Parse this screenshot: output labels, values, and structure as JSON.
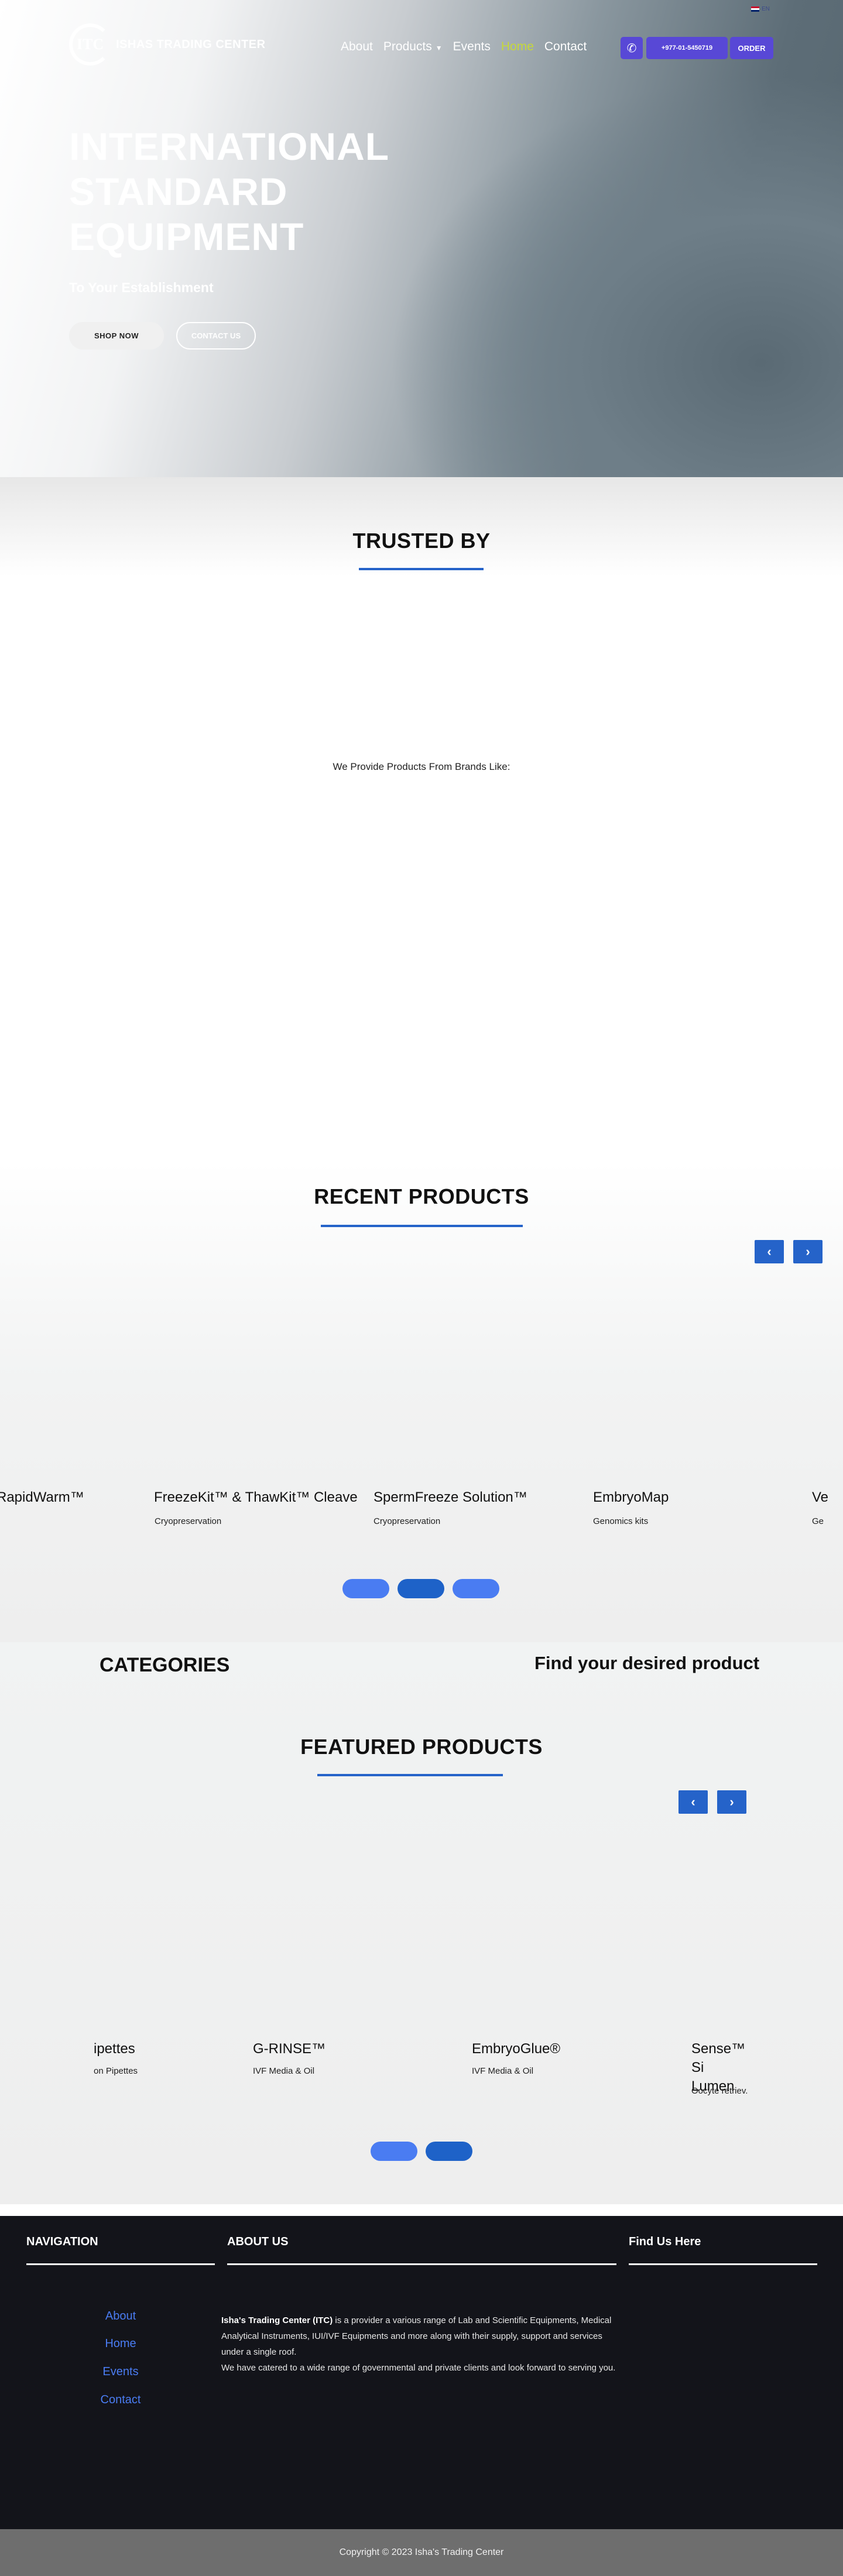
{
  "header": {
    "language": "EN",
    "logo_mark": "ITC",
    "brand_name": "ISHAS TRADING CENTER",
    "nav": [
      {
        "label": "About"
      },
      {
        "label": "Products"
      },
      {
        "label": "Events"
      },
      {
        "label": "Home"
      },
      {
        "label": "Contact"
      }
    ],
    "phone": "+977-01-5450719",
    "order_label": "ORDER"
  },
  "hero": {
    "title": "INTERNATIONAL STANDARD EQUIPMENT",
    "subtitle": "To Your Establishment",
    "shop_now": "SHOP NOW",
    "contact_us": "CONTACT US"
  },
  "trusted": {
    "title": "TRUSTED BY",
    "brands_text": "We Provide Products From Brands Like:"
  },
  "recent": {
    "title": "RECENT PRODUCTS",
    "prev": "‹",
    "next": "›",
    "items": [
      {
        "name": "RapidWarm™",
        "category": ""
      },
      {
        "name": "FreezeKit™ & ThawKit™ Cleave",
        "category": "Cryopreservation"
      },
      {
        "name": "SpermFreeze Solution™",
        "category": "Cryopreservation"
      },
      {
        "name": "EmbryoMap",
        "category": "Genomics kits"
      },
      {
        "name": "Ve",
        "category": "Ge"
      }
    ]
  },
  "categories": {
    "title": "CATEGORIES",
    "find_title": "Find your desired product"
  },
  "featured": {
    "title": "FEATURED PRODUCTS",
    "prev": "‹",
    "next": "›",
    "items": [
      {
        "name": "ipettes",
        "category": "on Pipettes"
      },
      {
        "name": "G-RINSE™",
        "category": "IVF Media & Oil"
      },
      {
        "name": "EmbryoGlue®",
        "category": "IVF Media & Oil"
      },
      {
        "name": "Sense™ Si Lumen",
        "category": "Oocyte retriev."
      }
    ]
  },
  "footer": {
    "nav_title": "NAVIGATION",
    "about_title": "ABOUT US",
    "find_title": "Find Us Here",
    "links": [
      {
        "label": "About"
      },
      {
        "label": "Home"
      },
      {
        "label": "Events"
      },
      {
        "label": "Contact"
      }
    ],
    "about_company": "Isha's Trading Center (ITC)",
    "about_p1": " is a provider a various range of Lab and Scientific Equipments, Medical  Analytical Instruments, IUI/IVF Equipments and more along with their supply, support and services under a single roof.",
    "about_p2": "We have catered to a wide range of governmental and private clients and look forward to serving you.",
    "copyright": "Copyright © 2023 Isha's Trading Center"
  },
  "colors": {
    "accent": "#5848d6",
    "blue": "#2563c9",
    "nav_active": "#c6d83a",
    "footer_bg": "#13141a"
  }
}
